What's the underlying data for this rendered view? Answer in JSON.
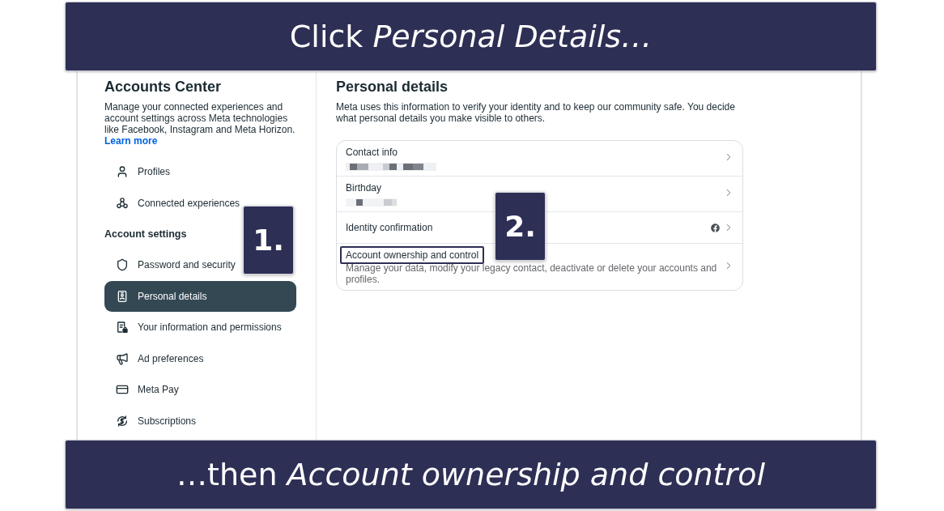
{
  "top_caption": {
    "text": "Click *Personal Details…*"
  },
  "sidebar": {
    "title": "Accounts Center",
    "description": "Manage your connected experiences and account settings across Meta technologies like Facebook, Instagram and Meta Horizon.",
    "link": "Learn more",
    "sections": [
      {
        "items": [
          {
            "label": "Profiles",
            "selected": false
          },
          {
            "label": "Connected experiences",
            "selected": false
          }
        ]
      },
      {
        "heading": "Account settings",
        "items": [
          {
            "label": "Password and security",
            "selected": false
          },
          {
            "label": "Personal details",
            "selected": true
          },
          {
            "label": "Your information and permissions",
            "selected": false
          },
          {
            "label": "Ad preferences",
            "selected": false
          },
          {
            "label": "Meta Pay",
            "selected": false
          },
          {
            "label": "Subscriptions",
            "selected": false
          }
        ]
      }
    ]
  },
  "main": {
    "title": "Personal details",
    "description": "Meta uses this information to verify your identity and to keep our community safe. You decide what personal details you make visible to others.",
    "rows": [
      {
        "kind": "masked_value",
        "label": "Contact info",
        "highlighted": false
      },
      {
        "kind": "masked_value",
        "label": "Birthday",
        "highlighted": false
      },
      {
        "kind": "linked_account",
        "label": "Identity confirmation",
        "highlighted": false
      },
      {
        "kind": "description",
        "label": "Account ownership and control",
        "description": "Manage your data, modify your legacy contact, deactivate or delete your accounts and profiles.",
        "highlighted": true
      }
    ]
  },
  "steps": [
    {
      "label": "1."
    },
    {
      "label": "2."
    }
  ],
  "bottom_caption": {
    "text": "…then *Account ownership and control*"
  }
}
